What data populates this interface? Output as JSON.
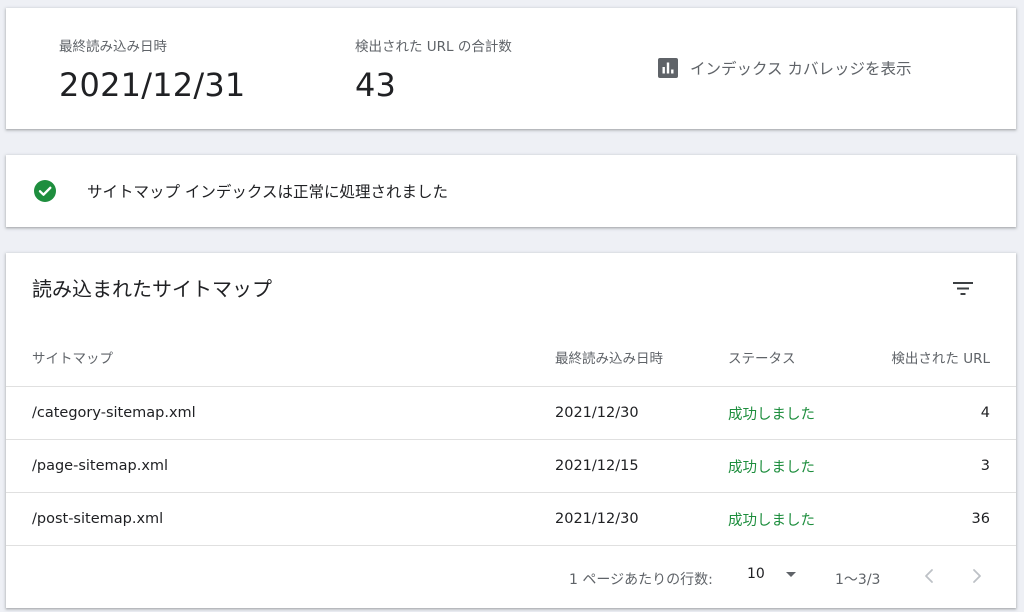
{
  "summary": {
    "last_read_label": "最終読み込み日時",
    "last_read_value": "2021/12/31",
    "url_count_label": "検出された URL の合計数",
    "url_count_value": "43",
    "coverage_link_label": "インデックス カバレッジを表示",
    "coverage_icon": "bar-chart-icon"
  },
  "status": {
    "icon": "check-circle-icon",
    "color": "#1e8e3e",
    "message": "サイトマップ インデックスは正常に処理されました"
  },
  "sitemaps": {
    "title": "読み込まれたサイトマップ",
    "filter_icon": "filter-icon",
    "columns": {
      "name": "サイトマップ",
      "last_read": "最終読み込み日時",
      "status": "ステータス",
      "urls": "検出された URL"
    },
    "rows": [
      {
        "name": "/category-sitemap.xml",
        "last_read": "2021/12/30",
        "status": "成功しました",
        "urls": "4"
      },
      {
        "name": "/page-sitemap.xml",
        "last_read": "2021/12/15",
        "status": "成功しました",
        "urls": "3"
      },
      {
        "name": "/post-sitemap.xml",
        "last_read": "2021/12/30",
        "status": "成功しました",
        "urls": "36"
      }
    ],
    "pagination": {
      "rows_per_page_label": "1 ページあたりの行数:",
      "rows_per_page_value": "10",
      "range": "1〜3/3"
    }
  }
}
